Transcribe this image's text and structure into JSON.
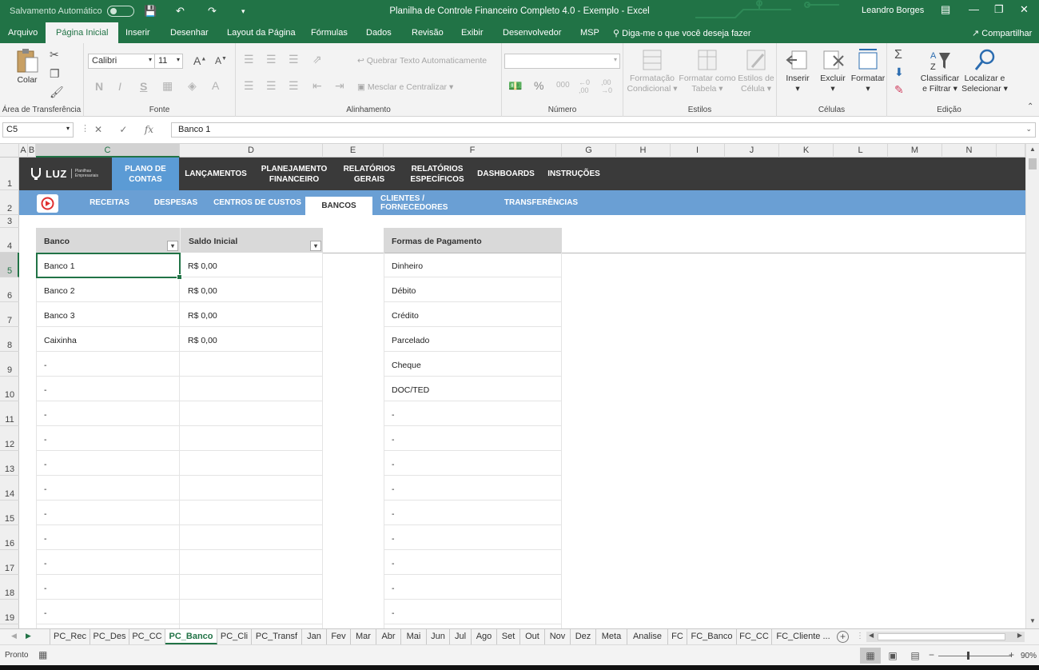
{
  "titlebar": {
    "autosave_label": "Salvamento Automático",
    "doc_title": "Planilha de Controle Financeiro Completo 4.0 - Exemplo  -  Excel",
    "user": "Leandro Borges"
  },
  "menu": {
    "tabs": [
      "Arquivo",
      "Página Inicial",
      "Inserir",
      "Desenhar",
      "Layout da Página",
      "Fórmulas",
      "Dados",
      "Revisão",
      "Exibir",
      "Desenvolvedor",
      "MSP"
    ],
    "active": "Página Inicial",
    "tell_me": "Diga-me o que você deseja fazer",
    "share": "Compartilhar"
  },
  "ribbon": {
    "paste": "Colar",
    "clipboard": "Área de Transferência",
    "font_name": "Calibri",
    "font_size": "11",
    "font_group": "Fonte",
    "bold": "N",
    "italic": "I",
    "underline": "S",
    "wrap_text": "Quebrar Texto Automaticamente",
    "merge_center": "Mesclar e Centralizar",
    "alignment_group": "Alinhamento",
    "number_group": "Número",
    "conditional_l1": "Formatação",
    "conditional_l2": "Condicional",
    "format_table_l1": "Formatar como",
    "format_table_l2": "Tabela",
    "cell_styles_l1": "Estilos de",
    "cell_styles_l2": "Célula",
    "styles_group": "Estilos",
    "insert": "Inserir",
    "delete": "Excluir",
    "format": "Formatar",
    "cells_group": "Células",
    "sort_l1": "Classificar",
    "sort_l2": "e Filtrar",
    "find_l1": "Localizar e",
    "find_l2": "Selecionar",
    "editing_group": "Edição"
  },
  "formula_bar": {
    "name_box": "C5",
    "fx": "fx",
    "content": "Banco 1"
  },
  "columns": [
    "A",
    "B",
    "C",
    "D",
    "E",
    "F",
    "G",
    "H",
    "I",
    "J",
    "K",
    "L",
    "M",
    "N"
  ],
  "rows": [
    "1",
    "2",
    "3",
    "4",
    "5",
    "6",
    "7",
    "8",
    "9",
    "10",
    "11",
    "12",
    "13",
    "14",
    "15",
    "16",
    "17",
    "18",
    "19"
  ],
  "nav": {
    "logo": "LUZ",
    "logo_sub_1": "Planilhas",
    "logo_sub_2": "Empresariais",
    "items": [
      {
        "l1": "PLANO DE",
        "l2": "CONTAS"
      },
      {
        "l1": "LANÇAMENTOS",
        "l2": ""
      },
      {
        "l1": "PLANEJAMENTO",
        "l2": "FINANCEIRO"
      },
      {
        "l1": "RELATÓRIOS",
        "l2": "GERAIS"
      },
      {
        "l1": "RELATÓRIOS",
        "l2": "ESPECÍFICOS"
      },
      {
        "l1": "DASHBOARDS",
        "l2": ""
      },
      {
        "l1": "INSTRUÇÕES",
        "l2": ""
      }
    ]
  },
  "subnav": {
    "items": [
      "RECEITAS",
      "DESPESAS",
      "CENTROS DE CUSTOS",
      "BANCOS",
      "CLIENTES / FORNECEDORES",
      "TRANSFERÊNCIAS"
    ]
  },
  "table": {
    "header_banco": "Banco",
    "header_saldo": "Saldo Inicial",
    "header_pagamento": "Formas de Pagamento",
    "bancos": [
      "Banco 1",
      "Banco 2",
      "Banco 3",
      "Caixinha",
      "-",
      "-",
      "-",
      "-",
      "-",
      "-",
      "-",
      "-",
      "-",
      "-",
      "-"
    ],
    "saldos": [
      "R$ 0,00",
      "R$ 0,00",
      "R$ 0,00",
      "R$ 0,00",
      "",
      "",
      "",
      "",
      "",
      "",
      "",
      "",
      "",
      "",
      ""
    ],
    "pagamentos": [
      "Dinheiro",
      "Débito",
      "Crédito",
      "Parcelado",
      "Cheque",
      "DOC/TED",
      "-",
      "-",
      "-",
      "-",
      "-",
      "-",
      "-",
      "-",
      "-"
    ]
  },
  "sheets": {
    "tabs": [
      "PC_Rec",
      "PC_Des",
      "PC_CC",
      "PC_Banco",
      "PC_Cli",
      "PC_Transf",
      "Jan",
      "Fev",
      "Mar",
      "Abr",
      "Mai",
      "Jun",
      "Jul",
      "Ago",
      "Set",
      "Out",
      "Nov",
      "Dez",
      "Meta",
      "Analise",
      "FC",
      "FC_Banco",
      "FC_CC",
      "FC_Cliente ..."
    ],
    "active": "PC_Banco"
  },
  "status": {
    "ready": "Pronto",
    "zoom": "90%"
  }
}
